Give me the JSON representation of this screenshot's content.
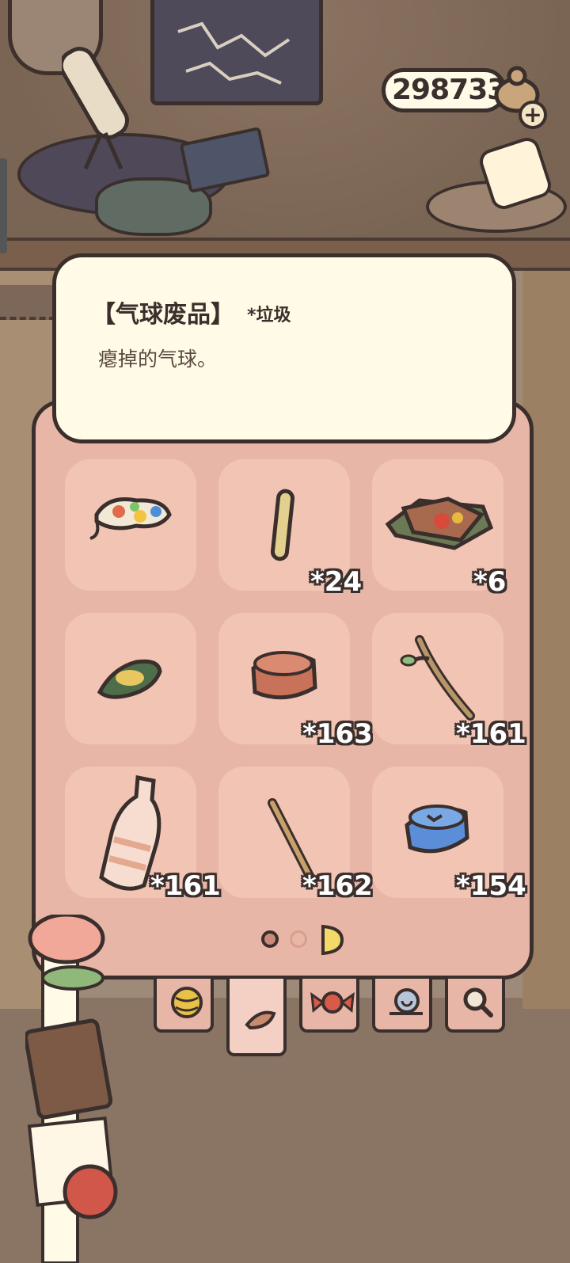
{
  "currency": {
    "coins": "298733",
    "add_icon": "plus-icon"
  },
  "item_detail": {
    "name": "【气球废品】",
    "category": "*垃圾",
    "description": "瘪掉的气球。"
  },
  "inventory": {
    "items": [
      {
        "icon": "deflated-balloon-icon",
        "count": ""
      },
      {
        "icon": "stick-icon",
        "count": "*24"
      },
      {
        "icon": "broken-box-icon",
        "count": "*6"
      },
      {
        "icon": "leaf-scrap-icon",
        "count": ""
      },
      {
        "icon": "bottle-cap-brown-icon",
        "count": "*163"
      },
      {
        "icon": "twig-icon",
        "count": "*161"
      },
      {
        "icon": "plastic-bottle-icon",
        "count": "*161"
      },
      {
        "icon": "straw-icon",
        "count": "*162"
      },
      {
        "icon": "bottle-cap-blue-icon",
        "count": "*154"
      }
    ],
    "page_indicator": {
      "current": 1,
      "total": 2
    }
  },
  "tabs": [
    {
      "icon": "ball-icon",
      "active": false
    },
    {
      "icon": "leaf-icon",
      "active": true
    },
    {
      "icon": "candy-icon",
      "active": false
    },
    {
      "icon": "snail-icon",
      "active": false
    },
    {
      "icon": "magnifier-icon",
      "active": false
    }
  ],
  "colors": {
    "panel": "#e8b6a7",
    "slot": "#f2c4b4",
    "card": "#fffbe6",
    "outline": "#3a2f2c"
  }
}
